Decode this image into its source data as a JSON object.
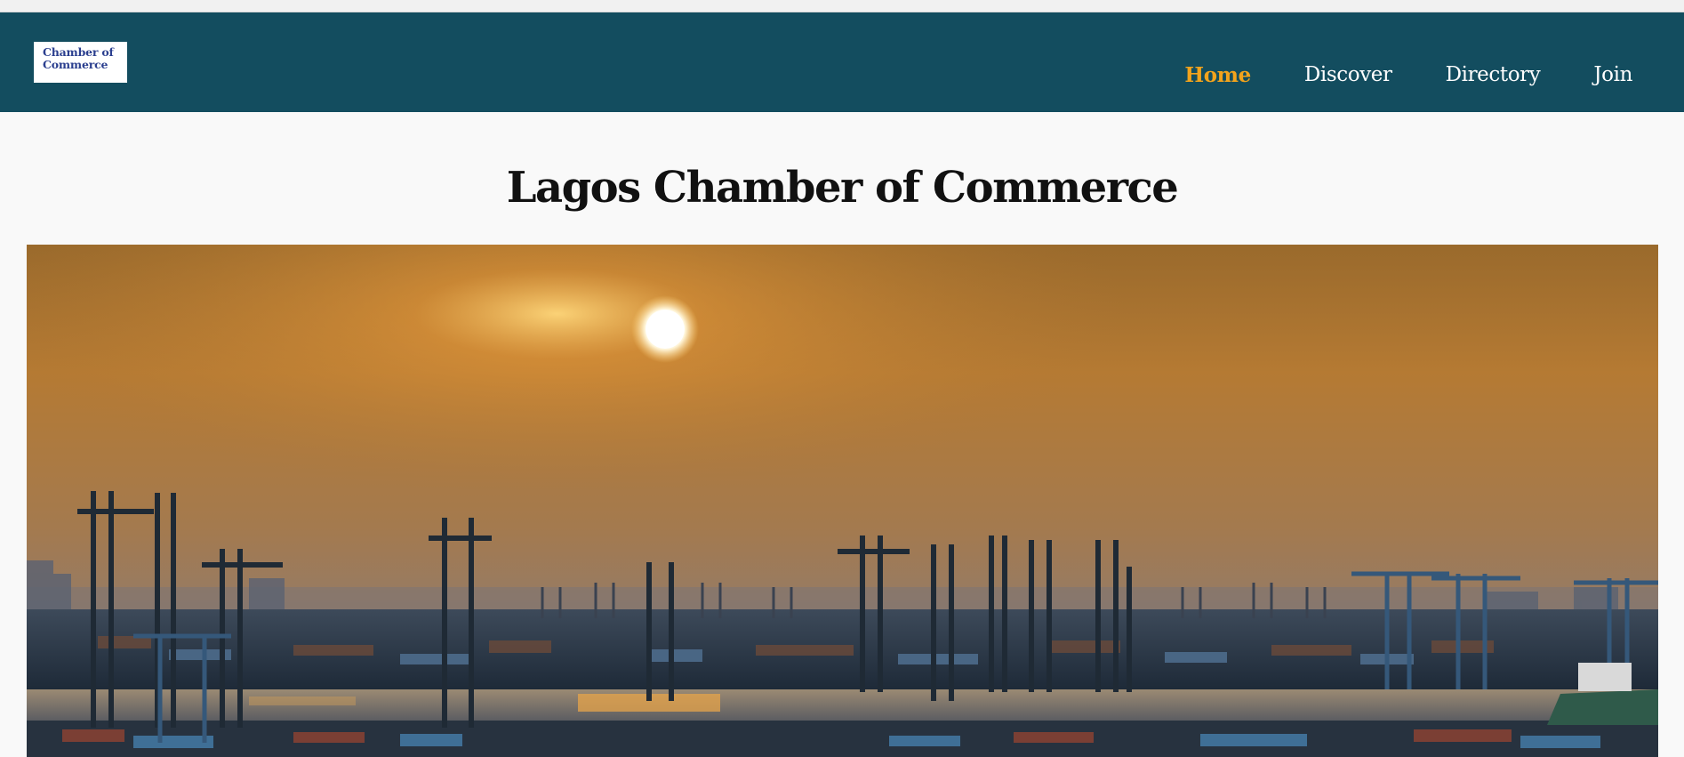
{
  "logo": {
    "line1": "Chamber of",
    "line2": "Commerce"
  },
  "nav": {
    "items": [
      {
        "label": "Home",
        "active": true
      },
      {
        "label": "Discover",
        "active": false
      },
      {
        "label": "Directory",
        "active": false
      },
      {
        "label": "Join",
        "active": false
      }
    ]
  },
  "page_title": "Lagos Chamber of Commerce",
  "colors": {
    "header_bg": "#134d5f",
    "nav_active": "#f2a31c",
    "nav_text": "#ffffff",
    "page_bg": "#f9f9f9"
  }
}
